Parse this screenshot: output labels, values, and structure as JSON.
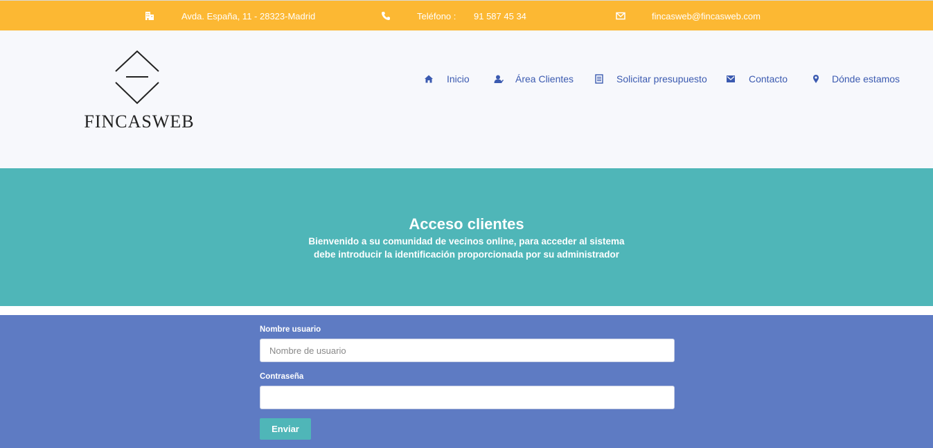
{
  "topbar": {
    "address": "Avda. España, 11 - 28323-Madrid",
    "phone_label": "Teléfono :",
    "phone": "91 587 45 34",
    "email": "fincasweb@fincasweb.com"
  },
  "logo": {
    "text": "FINCASWEB"
  },
  "nav": [
    {
      "label": "Inicio",
      "icon": "home-icon"
    },
    {
      "label": "Área Clientes",
      "icon": "user-icon"
    },
    {
      "label": "Solicitar presupuesto",
      "icon": "document-icon"
    },
    {
      "label": "Contacto",
      "icon": "envelope-icon"
    },
    {
      "label": "Dónde estamos",
      "icon": "map-marker-icon"
    }
  ],
  "hero": {
    "title": "Acceso clientes",
    "subtitle_line1": "Bienvenido a su comunidad de vecinos online, para acceder al sistema",
    "subtitle_line2": "debe introducir la identificación proporcionada por su administrador"
  },
  "form": {
    "username_label": "Nombre usuario",
    "username_placeholder": "Nombre de usuario",
    "username_value": "",
    "password_label": "Contraseña",
    "password_value": "",
    "submit_label": "Enviar"
  },
  "colors": {
    "topbar": "#fcb833",
    "header": "#f7f8fc",
    "hero": "#4fb6b8",
    "form": "#5e7bc3",
    "nav_text": "#3b5ab0"
  }
}
